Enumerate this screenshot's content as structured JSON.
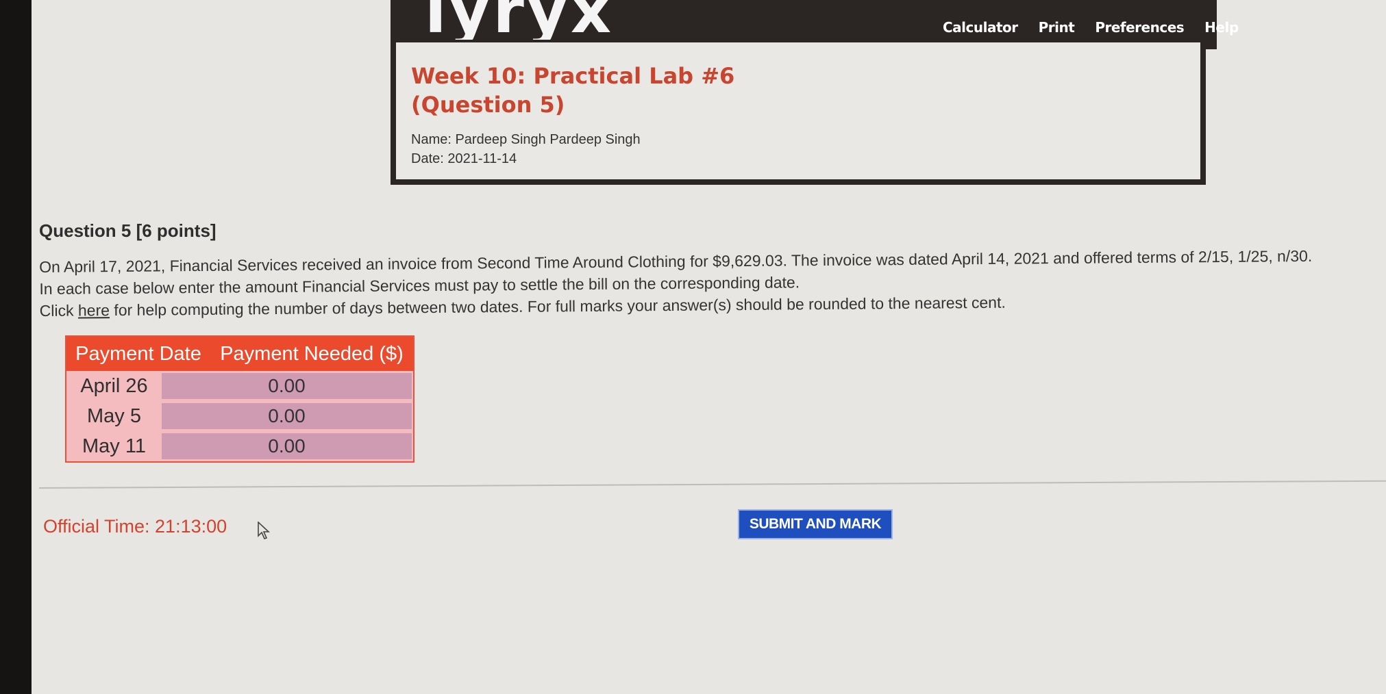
{
  "header": {
    "logo": "lyryx",
    "nav": [
      "Calculator",
      "Print",
      "Preferences",
      "Help"
    ]
  },
  "info": {
    "title_line1": "Week 10: Practical Lab #6",
    "title_line2": "(Question 5)",
    "name": "Name: Pardeep Singh Pardeep Singh",
    "date": "Date: 2021-11-14"
  },
  "question": {
    "title": "Question 5 [6 points]",
    "line1": "On April 17, 2021, Financial Services received an invoice from Second Time Around Clothing for $9,629.03. The invoice was dated April 14, 2021 and offered terms of 2/15, 1/25, n/30.",
    "line2": "In each case below enter the amount Financial Services must pay to settle the bill on the corresponding date.",
    "line3_prefix": "Click ",
    "line3_link": "here",
    "line3_suffix": " for help computing the number of days between two dates. For full marks your answer(s) should be rounded to the nearest cent."
  },
  "table": {
    "headers": [
      "Payment Date",
      "Payment Needed ($)"
    ],
    "rows": [
      {
        "date": "April 26",
        "value": "0.00"
      },
      {
        "date": "May 5",
        "value": "0.00"
      },
      {
        "date": "May 11",
        "value": "0.00"
      }
    ]
  },
  "footer": {
    "official_time": "Official Time: 21:13:00",
    "submit_label": "SUBMIT AND MARK"
  },
  "colors": {
    "accent_red": "#ec4a2c",
    "submit_blue": "#1f4fbf",
    "title_red": "#c8452f"
  }
}
